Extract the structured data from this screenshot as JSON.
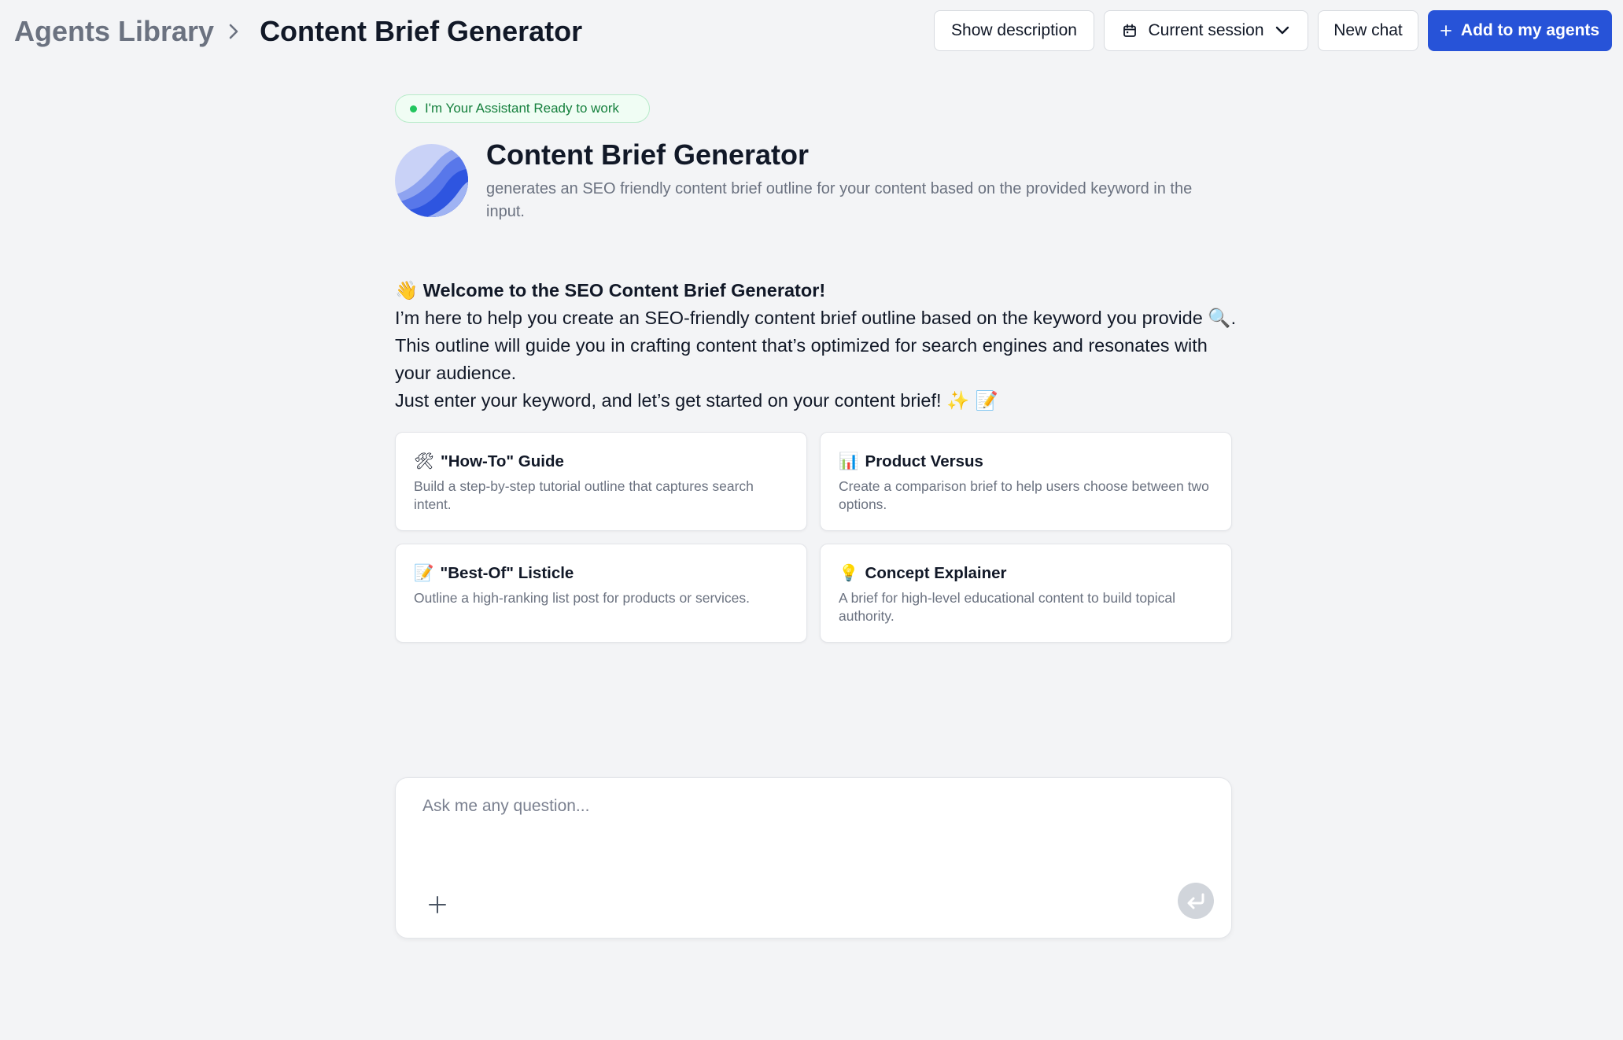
{
  "breadcrumb": {
    "parent": "Agents Library",
    "current": "Content Brief Generator"
  },
  "header": {
    "show_description_label": "Show description",
    "session_label": "Current session",
    "new_chat_label": "New chat",
    "add_label": "Add to my agents",
    "icons": {
      "separator": "chevron-right-icon",
      "session": "calendar-icon",
      "dropdown": "chevron-down-icon",
      "add": "plus-icon"
    }
  },
  "agent": {
    "status": "I'm Your Assistant Ready to work",
    "name": "Content Brief Generator",
    "description": "generates an SEO friendly content brief outline for your content based on the provided keyword in the input."
  },
  "welcome": {
    "title_emoji": "👋",
    "title": "Welcome to the SEO Content Brief Generator!",
    "line1_a": "I’m here to help you create an SEO-friendly content brief outline based on the keyword you provide ",
    "line1_emoji": "🔍",
    "line1_b": ". This outline will guide you in crafting content that’s optimized for search engines and resonates with your audience.",
    "line2": "Just enter your keyword, and let’s get started on your content brief!",
    "line2_emoji": "✨ 📝"
  },
  "suggestions": [
    {
      "emoji": "🛠",
      "title": "\"How-To\" Guide",
      "description": "Build a step-by-step tutorial outline that captures search intent."
    },
    {
      "emoji": "📊",
      "title": "Product Versus",
      "description": "Create a comparison brief to help users choose between two options."
    },
    {
      "emoji": "📝",
      "title": "\"Best-Of\" Listicle",
      "description": "Outline a high-ranking list post for products or services."
    },
    {
      "emoji": "💡",
      "title": "Concept Explainer",
      "description": "A brief for high-level educational content to build topical authority."
    }
  ],
  "composer": {
    "placeholder": "Ask me any question...",
    "value": "",
    "attach_icon": "plus-icon",
    "send_icon": "enter-arrow-icon"
  },
  "colors": {
    "background": "#f3f4f6",
    "primary": "#2753d8",
    "status_green": "#15803d",
    "status_dot": "#22c55e",
    "muted_text": "#6b7280"
  }
}
